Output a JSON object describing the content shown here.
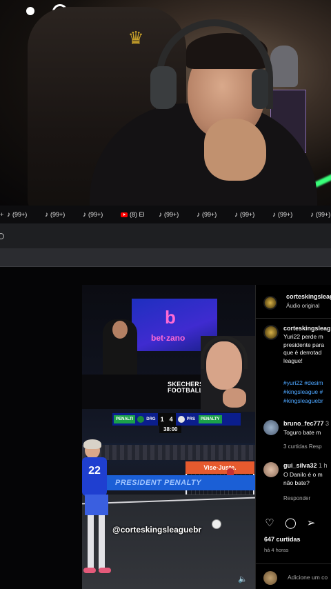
{
  "browser": {
    "tabs": [
      {
        "icon": "tiktok-icon",
        "label": "(99+)"
      },
      {
        "icon": "tiktok-icon",
        "label": "(99+)"
      },
      {
        "icon": "tiktok-icon",
        "label": "(99+)"
      },
      {
        "icon": "youtube-icon",
        "label": "(8) El"
      },
      {
        "icon": "tiktok-icon",
        "label": "(99+)"
      },
      {
        "icon": "tiktok-icon",
        "label": "(99+)"
      },
      {
        "icon": "tiktok-icon",
        "label": "(99+)"
      },
      {
        "icon": "tiktok-icon",
        "label": "(99+)"
      },
      {
        "icon": "tiktok-icon",
        "label": "(99+)"
      }
    ]
  },
  "video": {
    "sponsor_letter": "b",
    "sponsor_name": "bet·zano",
    "skechers_line1": "SKECHERS",
    "skechers_line2": "FOOTBALL",
    "scoreboard": {
      "left_tag": "PENALTI",
      "left_team": "DRG",
      "score_left": "1",
      "score_right": "4",
      "right_team": "PRS",
      "right_tag": "PENALTY",
      "clock": "38:00"
    },
    "adboard": "PRESIDENT PENALTY",
    "adboard_right": "Vise·Juste.",
    "player_number": "22",
    "watermark": "@corteskingsleaguebr"
  },
  "post": {
    "account": "corteskingsleaguebr",
    "audio": "Áudio original",
    "caption_user": "corteskingsleaguebr",
    "caption_lines": [
      "Yuri22 perde m",
      "presidente para",
      "que é derrotad",
      "league!"
    ],
    "hashtags": [
      "#yuri22 #desim",
      "#kingsleague #",
      "#kingsleaguebr"
    ],
    "comments": [
      {
        "user": "bruno_fec777",
        "time": "3",
        "text": [
          "Toguro bate m"
        ],
        "meta": "3 curtidas   Resp"
      },
      {
        "user": "gui_silva32",
        "time": "1 h",
        "text": [
          "O Danilo é o m",
          "não bate?"
        ],
        "meta": "Responder"
      }
    ],
    "likes": "647 curtidas",
    "posted": "há 4 horas",
    "add_comment": "Adicione um co"
  }
}
